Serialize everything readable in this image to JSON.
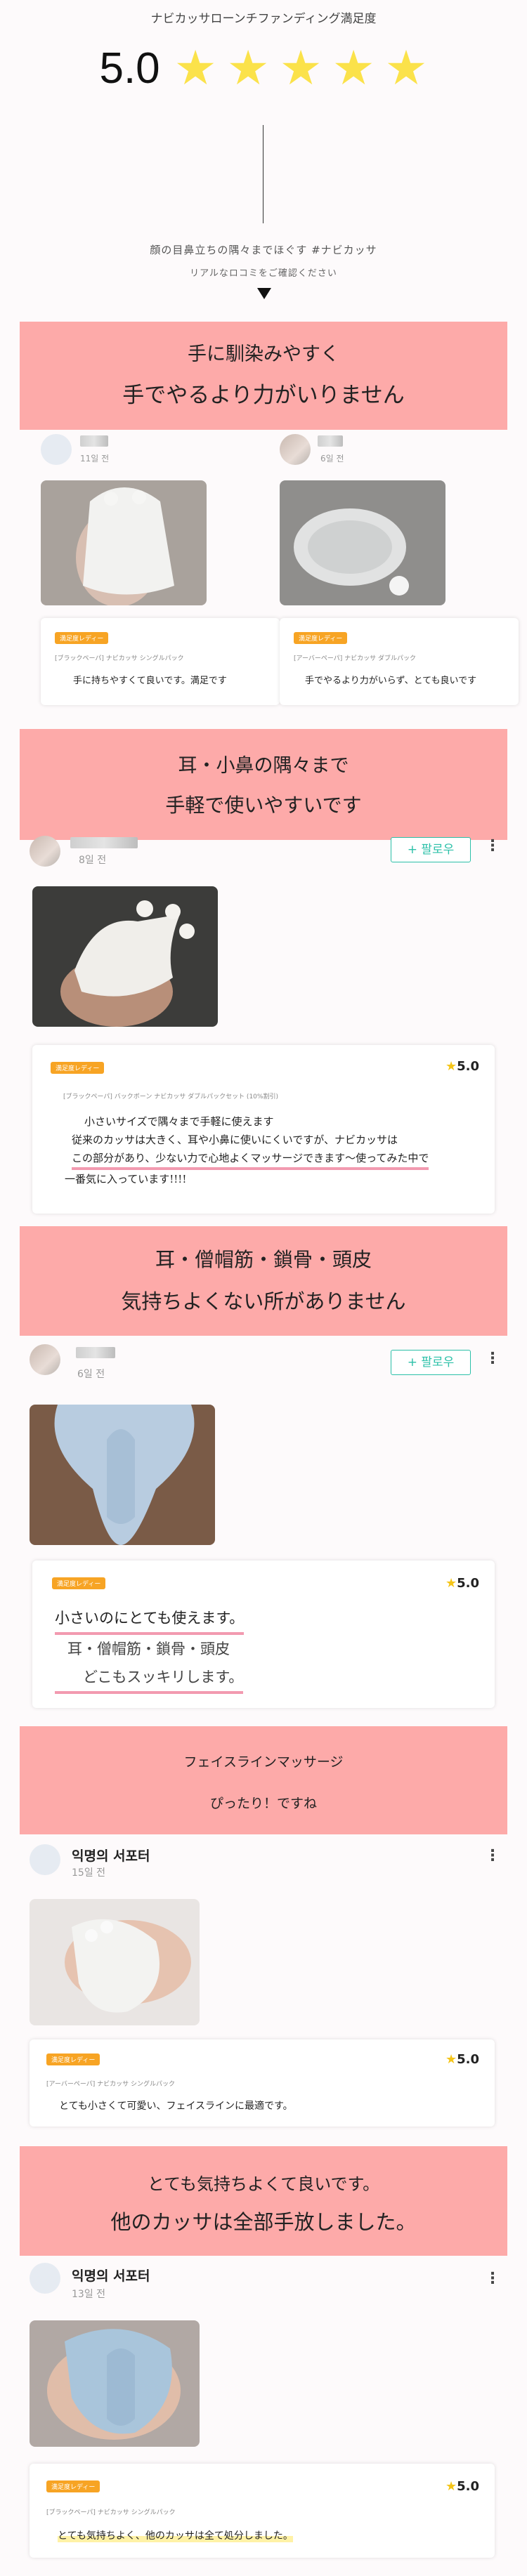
{
  "header": {
    "survey_title": "ナビカッサローンチファンディング満足度",
    "rating": "5.0",
    "stars": "★★★★★",
    "intro_line": "顔の目鼻立ちの隅々までほぐす #ナビカッサ",
    "intro_sub": "リアルなロコミをご確認ください"
  },
  "colors": {
    "banner_bg": "#fdaaa9",
    "star": "#fbe24a",
    "follow": "#2bc0a8",
    "badge": "#f7a424"
  },
  "section1": {
    "banner_l1": "手に馴染みやすく",
    "banner_l2": "手でやるより力がいりません",
    "left": {
      "time": "11일 전",
      "badge": "満足度レディー",
      "meta": "[ブラックペーパ] ナビカッサ シングルパック",
      "text": "手に持ちやすくて良いです。満足です"
    },
    "right": {
      "time": "6일 전",
      "badge": "満足度レディー",
      "meta": "[アーバーペーパ] ナビカッサ ダブルパック",
      "text": "手でやるより力がいらず、とても良いです"
    }
  },
  "section2": {
    "banner_l1": "耳・小鼻の隅々まで",
    "banner_l2": "手軽で使いやすいです",
    "time": "8일 전",
    "follow": "+ 팔로우",
    "badge": "満足度レディー",
    "score": "5.0",
    "meta": "[ブラックペーパ] バックボーン ナビカッサ ダブルパックセット (10%割引)",
    "lines": [
      "小さいサイズで隅々まで手軽に使えます",
      "従来のカッサは大きく、耳や小鼻に使いにくいですが、ナビカッサは",
      "この部分があり、少ない力で心地よくマッサージできます〜使ってみた中で",
      "一番気に入っています!!!!"
    ]
  },
  "section3": {
    "banner_l1": "耳・僧帽筋・鎖骨・頭皮",
    "banner_l2": "気持ちよくない所がありません",
    "time": "6일 전",
    "follow": "+ 팔로우",
    "badge": "満足度レディー",
    "score": "5.0",
    "lines": [
      "小さいのにとても使えます。",
      "耳・僧帽筋・鎖骨・頭皮",
      "どこもスッキリします。"
    ]
  },
  "section4": {
    "banner_l1": "フェイスラインマッサージ",
    "banner_l2": "ぴったり！ですね",
    "nick": "익명의 서포터",
    "time": "15일 전",
    "badge": "満足度レディー",
    "score": "5.0",
    "meta": "[アーバーペーパ] ナビカッサ シングルパック",
    "text": "とても小さくて可愛い、フェイスラインに最適です。"
  },
  "section5": {
    "banner_l1": "とても気持ちよくて良いです。",
    "banner_l2": "他のカッサは全部手放しました。",
    "nick": "익명의 서포터",
    "time": "13일 전",
    "badge": "満足度レディー",
    "score": "5.0",
    "meta": "[ブラックペーパ] ナビカッサ シングルパック",
    "text": "とても気持ちよく、他のカッサは全て処分しました。"
  },
  "icons": {
    "kebab": "⋮",
    "star": "★"
  }
}
